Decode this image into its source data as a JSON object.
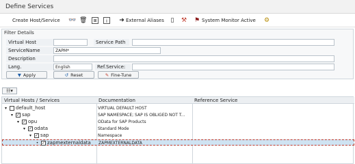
{
  "window": {
    "title": "Define Services"
  },
  "toolbar": {
    "create_label": "Create Host/Service",
    "external_aliases_label": "External Aliases",
    "system_monitor_label": "System Monitor Active",
    "icons": [
      "glasses-icon",
      "trash-icon",
      "hierarchy-icon",
      "info-icon",
      "arrow-right-icon",
      "document-icon",
      "tools-icon",
      "flag-icon",
      "tree-icon"
    ]
  },
  "filter": {
    "header": "Filter Details",
    "virtual_host_label": "Virtual Host",
    "virtual_host_value": "",
    "service_path_label": "Service Path",
    "service_path_value": "",
    "service_name_label": "ServiceName",
    "service_name_value": "ZAPM*",
    "description_label": "Description",
    "description_value": "",
    "lang_label": "Lang.",
    "lang_value": "English",
    "ref_service_label": "Ref.Service:",
    "ref_service_value": "",
    "apply_label": "Apply",
    "reset_label": "Reset",
    "finetune_label": "Fine-Tune"
  },
  "tree": {
    "columns": [
      "Virtual Hosts / Services",
      "Documentation",
      "Reference Service"
    ],
    "rows": [
      {
        "name": "default_host",
        "doc": "VIRTUAL DEFAULT HOST",
        "level": 0
      },
      {
        "name": "sap",
        "doc": "SAP NAMESPACE; SAP IS OBLIGED NOT T...",
        "level": 1
      },
      {
        "name": "opu",
        "doc": "OData for SAP Products",
        "level": 2
      },
      {
        "name": "odata",
        "doc": "Standard Mode",
        "level": 3
      },
      {
        "name": "sap",
        "doc": "Namespace",
        "level": 4
      },
      {
        "name": "zapmexternaldata",
        "doc": "ZAPMEXTERNALDATA",
        "level": 5
      }
    ]
  }
}
